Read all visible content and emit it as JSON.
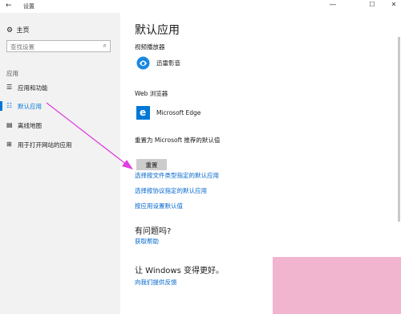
{
  "window": {
    "title": "设置",
    "back": "←",
    "minimize": "—",
    "maximize": "☐",
    "close": "✕"
  },
  "sidebar": {
    "home": "主页",
    "search_placeholder": "查找设置",
    "section": "应用",
    "items": [
      {
        "label": "应用和功能",
        "icon": "list-icon"
      },
      {
        "label": "默认应用",
        "icon": "default-apps-icon"
      },
      {
        "label": "离线地图",
        "icon": "map-icon"
      },
      {
        "label": "用于打开网站的应用",
        "icon": "web-apps-icon"
      }
    ],
    "active_index": 1
  },
  "main": {
    "title": "默认应用",
    "video_label": "视频播放器",
    "video_app": "迅雷影音",
    "web_label": "Web 浏览器",
    "web_app": "Microsoft Edge",
    "reset_label": "重置为 Microsoft 推荐的默认值",
    "reset_button": "重置",
    "links": [
      "选择按文件类型指定的默认应用",
      "选择按协议指定的默认应用",
      "按应用设置默认值"
    ],
    "question_title": "有问题吗?",
    "question_link": "获取帮助",
    "improve_title": "让 Windows 变得更好。",
    "improve_link": "向我们提供反馈"
  },
  "colors": {
    "accent": "#0078d7",
    "link": "#0066cc",
    "annotation_arrow": "#e040e0",
    "watermark": "#f0a8c8"
  }
}
